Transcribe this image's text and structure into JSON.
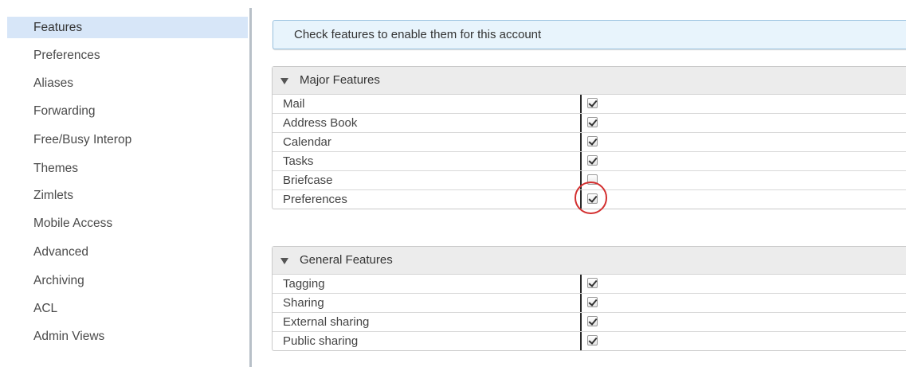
{
  "sidebar": {
    "items": [
      {
        "label": "Features",
        "selected": true
      },
      {
        "label": "Preferences",
        "selected": false
      },
      {
        "label": "Aliases",
        "selected": false
      },
      {
        "label": "Forwarding",
        "selected": false
      },
      {
        "label": "Free/Busy Interop",
        "selected": false
      },
      {
        "label": "Themes",
        "selected": false
      },
      {
        "label": "Zimlets",
        "selected": false
      },
      {
        "label": "Mobile Access",
        "selected": false
      },
      {
        "label": "Advanced",
        "selected": false
      },
      {
        "label": "Archiving",
        "selected": false
      },
      {
        "label": "ACL",
        "selected": false
      },
      {
        "label": "Admin Views",
        "selected": false
      }
    ]
  },
  "banner": {
    "text": "Check features to enable them for this account"
  },
  "sections": [
    {
      "title": "Major Features",
      "expanded": true,
      "rows": [
        {
          "label": "Mail",
          "checked": true
        },
        {
          "label": "Address Book",
          "checked": true
        },
        {
          "label": "Calendar",
          "checked": true
        },
        {
          "label": "Tasks",
          "checked": true
        },
        {
          "label": "Briefcase",
          "checked": false
        },
        {
          "label": "Preferences",
          "checked": true
        }
      ]
    },
    {
      "title": "General Features",
      "expanded": true,
      "rows": [
        {
          "label": "Tagging",
          "checked": true
        },
        {
          "label": "Sharing",
          "checked": true
        },
        {
          "label": "External sharing",
          "checked": true
        },
        {
          "label": "Public sharing",
          "checked": true
        }
      ]
    }
  ],
  "colors": {
    "selected_bg": "#d7e6f8",
    "banner_bg": "#e8f4fc",
    "annotation": "#d32f2f"
  }
}
